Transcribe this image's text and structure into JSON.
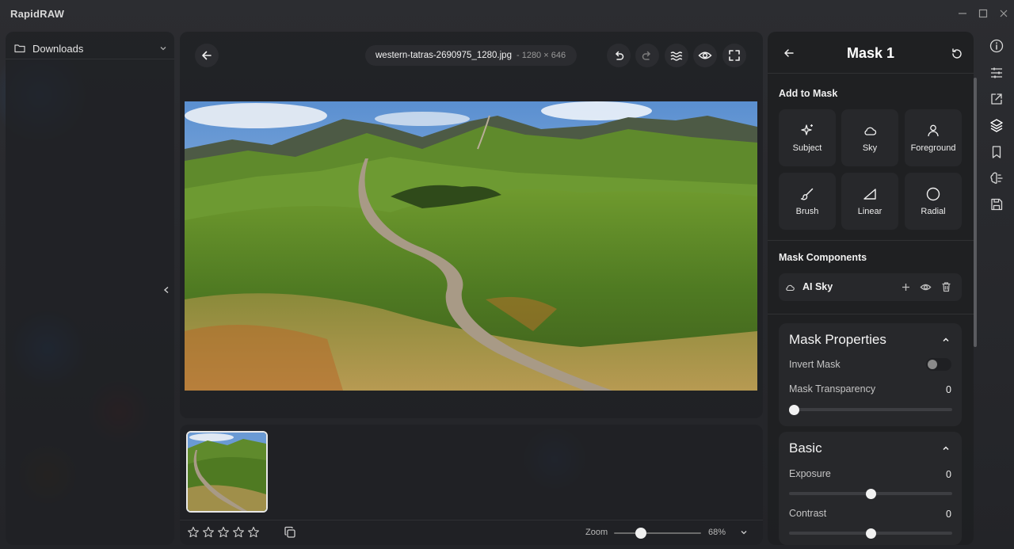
{
  "app": {
    "title": "RapidRAW"
  },
  "left_panel": {
    "folder": "Downloads"
  },
  "viewer": {
    "file_name": "western-tatras-2690975_1280.jpg",
    "file_dims": "- 1280 × 646"
  },
  "filmstrip": {
    "rating_stars": 5,
    "zoom_label": "Zoom",
    "zoom_value": "68%",
    "zoom_level": 0.28
  },
  "mask_panel": {
    "title": "Mask 1",
    "add_to_mask": "Add to Mask",
    "tools": [
      {
        "label": "Subject",
        "icon": "sparkles-icon"
      },
      {
        "label": "Sky",
        "icon": "cloud-icon"
      },
      {
        "label": "Foreground",
        "icon": "person-icon"
      },
      {
        "label": "Brush",
        "icon": "brush-icon"
      },
      {
        "label": "Linear",
        "icon": "linear-gradient-icon"
      },
      {
        "label": "Radial",
        "icon": "radial-circle-icon"
      }
    ],
    "components_title": "Mask Components",
    "component": {
      "label": "AI Sky",
      "icon": "cloud-icon"
    },
    "properties": {
      "title": "Mask Properties",
      "invert_label": "Invert Mask",
      "invert_on": false,
      "transparency_label": "Mask Transparency",
      "transparency_value": "0",
      "transparency_level": 0
    },
    "basic": {
      "title": "Basic",
      "exposure_label": "Exposure",
      "exposure_value": "0",
      "exposure_level": 0.5,
      "contrast_label": "Contrast",
      "contrast_value": "0",
      "contrast_level": 0.5
    }
  },
  "colors": {
    "panel": "#202124",
    "card": "#27282b",
    "accent": "#f2f2f2"
  }
}
